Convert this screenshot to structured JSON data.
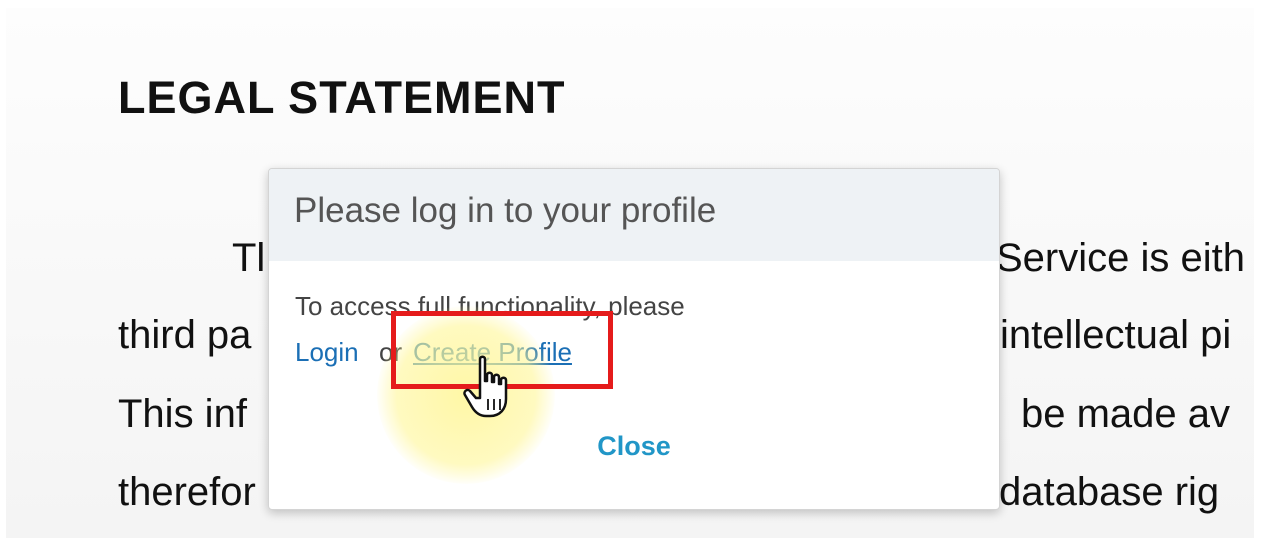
{
  "document": {
    "title": "LEGAL STATEMENT",
    "line_fragments": {
      "line1_left": "Tl",
      "line1_right": "Service is eith",
      "line2_left": "third pa",
      "line2_right": "intellectual pi",
      "line3_left": "This inf",
      "line3_right": "be made av",
      "line4_left": "therefor",
      "line4_right": "database  rig"
    }
  },
  "modal": {
    "title": "Please log in to your profile",
    "message": "To access full functionality, please",
    "login_label": "Login",
    "separator": "or",
    "create_profile_label": "Create Profile",
    "close_label": "Close"
  },
  "annotations": {
    "highlight_color": "#e51b1b",
    "click_indicator_color": "#fff696",
    "cursor_icon": "hand-pointer-icon"
  }
}
